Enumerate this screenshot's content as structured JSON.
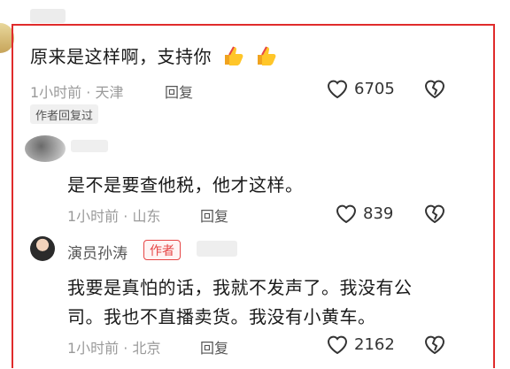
{
  "comments": [
    {
      "text": "原来是这样啊，支持你",
      "meta": "1小时前 · 天津",
      "reply_label": "回复",
      "likes": "6705",
      "author_replied": "作者回复过",
      "emoji": [
        "thumbs-up-icon",
        "thumbs-up-icon"
      ]
    },
    {
      "text": "是不是要查他税，他才这样。",
      "meta": "1小时前 · 山东",
      "reply_label": "回复",
      "likes": "839"
    },
    {
      "author_name": "演员孙涛",
      "author_badge": "作者",
      "text_line1": "我要是真怕的话，我就不发声了。我没有公",
      "text_line2": "司。我也不直播卖货。我没有小黄车。",
      "meta": "1小时前 · 北京",
      "reply_label": "回复",
      "likes": "2162"
    }
  ],
  "colors": {
    "frame": "#e02b2b",
    "author_badge": "#e64545",
    "meta": "#9a9a9a"
  }
}
